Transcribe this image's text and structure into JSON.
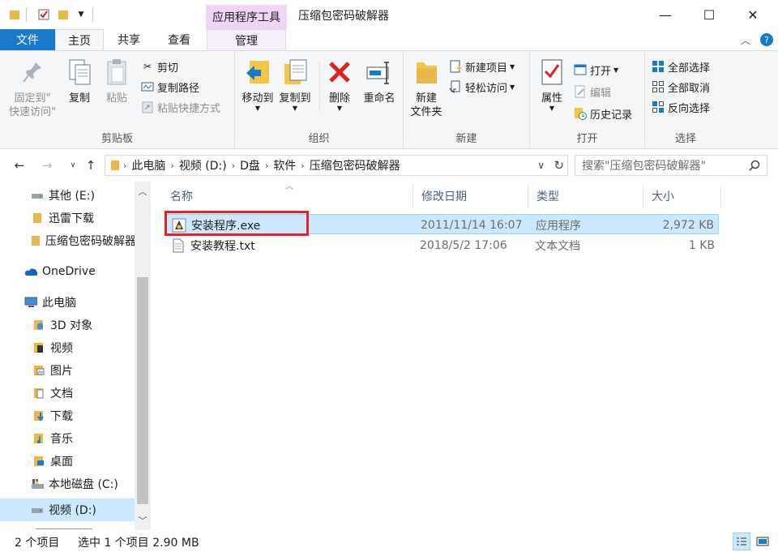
{
  "titlebar": {
    "context_tab": "应用程序工具",
    "title": "压缩包密码破解器",
    "minimize": "—",
    "maximize": "☐",
    "close": "✕"
  },
  "tabs": {
    "file": "文件",
    "home": "主页",
    "share": "共享",
    "view": "查看",
    "manage": "管理"
  },
  "ribbon": {
    "clipboard": {
      "label": "剪贴板",
      "pin_line1": "固定到\"",
      "pin_line2": "快速访问\"",
      "copy": "复制",
      "paste": "粘贴",
      "cut": "剪切",
      "copy_path": "复制路径",
      "paste_shortcut": "粘贴快捷方式"
    },
    "organize": {
      "label": "组织",
      "move_to": "移动到",
      "copy_to": "复制到",
      "delete": "删除",
      "rename": "重命名"
    },
    "new": {
      "label": "新建",
      "new_folder_line1": "新建",
      "new_folder_line2": "文件夹",
      "new_item": "新建项目",
      "easy_access": "轻松访问"
    },
    "open": {
      "label": "打开",
      "properties": "属性",
      "open": "打开",
      "edit": "编辑",
      "history": "历史记录"
    },
    "select": {
      "label": "选择",
      "select_all": "全部选择",
      "select_none": "全部取消",
      "invert": "反向选择"
    }
  },
  "address": {
    "crumbs": [
      "此电脑",
      "视频 (D:)",
      "D盘",
      "软件",
      "压缩包密码破解器"
    ],
    "search_placeholder": "搜索\"压缩包密码破解器\""
  },
  "nav": {
    "items": [
      {
        "label": "其他 (E:)",
        "icon": "drive-icon"
      },
      {
        "label": "迅雷下载",
        "icon": "folder-icon"
      },
      {
        "label": "压缩包密码破解器",
        "icon": "folder-icon"
      },
      {
        "label": "OneDrive",
        "icon": "cloud-icon"
      },
      {
        "label": "此电脑",
        "icon": "computer-icon"
      },
      {
        "label": "3D 对象",
        "icon": "folder-3d-icon"
      },
      {
        "label": "视频",
        "icon": "video-folder-icon"
      },
      {
        "label": "图片",
        "icon": "pictures-folder-icon"
      },
      {
        "label": "文档",
        "icon": "documents-folder-icon"
      },
      {
        "label": "下载",
        "icon": "downloads-folder-icon"
      },
      {
        "label": "音乐",
        "icon": "music-folder-icon"
      },
      {
        "label": "桌面",
        "icon": "desktop-folder-icon"
      },
      {
        "label": "本地磁盘 (C:)",
        "icon": "system-drive-icon"
      },
      {
        "label": "视频 (D:)",
        "icon": "drive-icon"
      }
    ]
  },
  "columns": {
    "name": "名称",
    "modified": "修改日期",
    "type": "类型",
    "size": "大小"
  },
  "files": [
    {
      "name": "安装程序.exe",
      "modified": "2011/11/14 16:07",
      "type": "应用程序",
      "size": "2,972 KB"
    },
    {
      "name": "安装教程.txt",
      "modified": "2018/5/2 17:06",
      "type": "文本文档",
      "size": "1 KB"
    }
  ],
  "status": {
    "count": "2 个项目",
    "selected": "选中 1 个项目  2.90 MB"
  },
  "colors": {
    "accent": "#1979ca",
    "context_tab": "#efd6f7",
    "selection": "#cce8ff",
    "highlight_box": "#e8202a",
    "delete_red": "#e0201b"
  }
}
